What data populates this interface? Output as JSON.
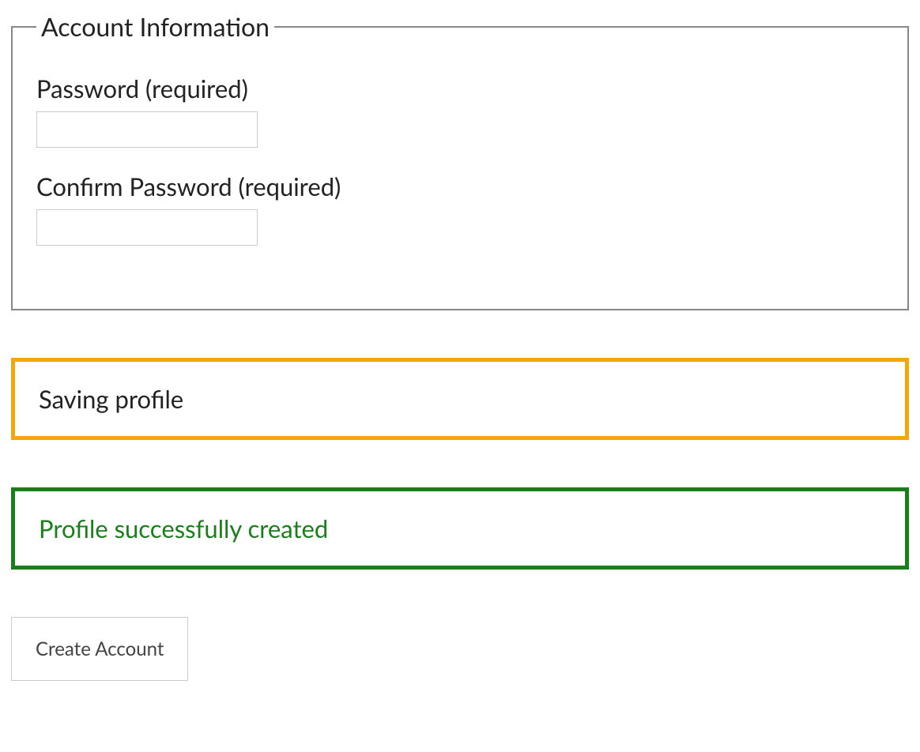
{
  "fieldset": {
    "legend": "Account Information",
    "password": {
      "label": "Password (required)",
      "value": ""
    },
    "confirm_password": {
      "label": "Confirm Password (required)",
      "value": ""
    }
  },
  "status": {
    "saving": "Saving profile",
    "success": "Profile successfully created"
  },
  "actions": {
    "submit_label": "Create Account"
  }
}
